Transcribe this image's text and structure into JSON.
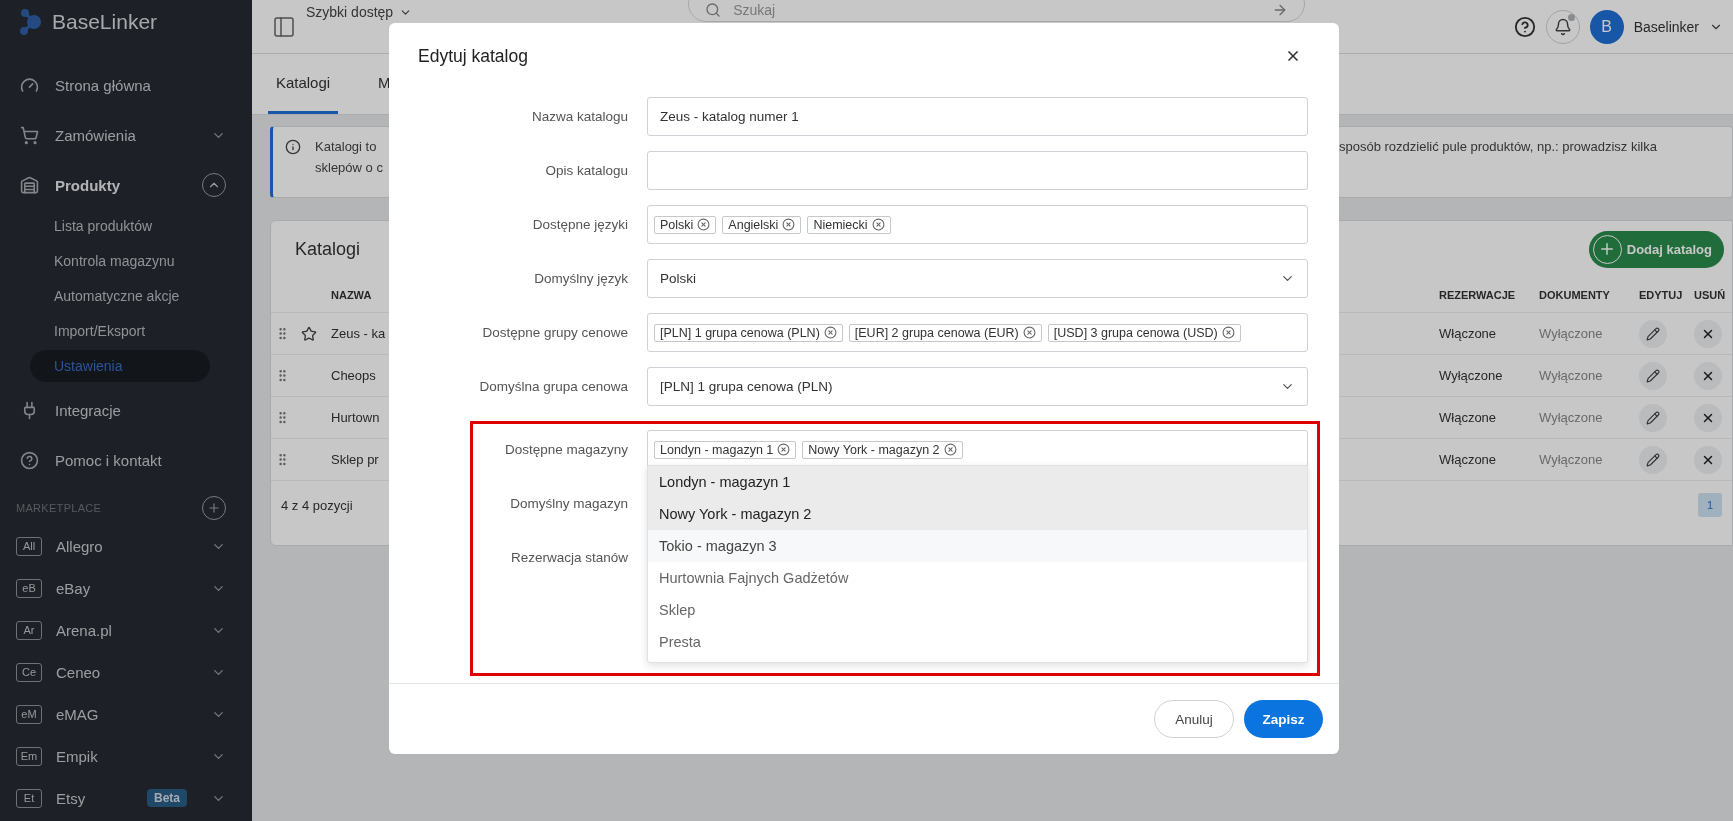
{
  "sidebar": {
    "logo": "BaseLinker",
    "nav": [
      {
        "label": "Strona główna",
        "kind": "link"
      },
      {
        "label": "Zamówienia",
        "kind": "group",
        "expanded": false
      },
      {
        "label": "Produkty",
        "kind": "group",
        "expanded": true,
        "children": [
          {
            "label": "Lista produktów",
            "selected": false
          },
          {
            "label": "Kontrola magazynu",
            "selected": false
          },
          {
            "label": "Automatyczne akcje",
            "selected": false
          },
          {
            "label": "Import/Eksport",
            "selected": false
          },
          {
            "label": "Ustawienia",
            "selected": true
          }
        ]
      },
      {
        "label": "Integracje",
        "kind": "link"
      },
      {
        "label": "Pomoc i kontakt",
        "kind": "link"
      }
    ],
    "marketplace": {
      "title": "MARKETPLACE",
      "items": [
        {
          "abbr": "All",
          "label": "Allegro"
        },
        {
          "abbr": "eB",
          "label": "eBay"
        },
        {
          "abbr": "Ar",
          "label": "Arena.pl"
        },
        {
          "abbr": "Ce",
          "label": "Ceneo"
        },
        {
          "abbr": "eM",
          "label": "eMAG"
        },
        {
          "abbr": "Em",
          "label": "Empik"
        },
        {
          "abbr": "Et",
          "label": "Etsy",
          "badge": "Beta"
        }
      ]
    }
  },
  "topbar": {
    "quick_access": "Szybki dostęp",
    "search": {
      "placeholder": "Szukaj"
    },
    "notifications": {
      "unread": true
    },
    "user": {
      "initial": "B",
      "name": "Baselinker"
    }
  },
  "tabs": [
    {
      "label": "Katalogi",
      "selected": true
    },
    {
      "label": "M",
      "selected": false
    }
  ],
  "info": {
    "left_lines": [
      "Katalogi to",
      "sklepów o c"
    ],
    "right_line": "sposób rozdzielić pule produktów, np.: prowadzisz kilka"
  },
  "catalogs": {
    "title": "Katalogi",
    "add_button": "Dodaj katalog",
    "columns": [
      "NAZWA",
      "REZERWACJE",
      "DOKUMENTY",
      "EDYTUJ",
      "USUŃ"
    ],
    "rows": [
      {
        "name": "Zeus - ka",
        "starred": true,
        "reservations": "Włączone",
        "documents": "Wyłączone"
      },
      {
        "name": "Cheops",
        "starred": false,
        "reservations": "Wyłączone",
        "documents": "Wyłączone"
      },
      {
        "name": "Hurtown",
        "starred": false,
        "reservations": "Włączone",
        "documents": "Wyłączone"
      },
      {
        "name": "Sklep pr",
        "starred": false,
        "reservations": "Włączone",
        "documents": "Wyłączone"
      }
    ],
    "count": "4 z 4 pozycji",
    "pages": [
      {
        "label": "1",
        "selected": true
      }
    ]
  },
  "modal": {
    "title": "Edytuj katalog",
    "fields": [
      {
        "label": "Nazwa katalogu",
        "kind": "text",
        "value": "Zeus - katalog numer 1"
      },
      {
        "label": "Opis katalogu",
        "kind": "text"
      },
      {
        "label": "Dostępne języki",
        "kind": "tags",
        "tags": [
          "Polski",
          "Angielski",
          "Niemiecki"
        ]
      },
      {
        "label": "Domyślny język",
        "kind": "select",
        "value": "Polski"
      },
      {
        "label": "Dostępne grupy cenowe",
        "kind": "tags",
        "tags": [
          "[PLN] 1 grupa cenowa (PLN)",
          "[EUR] 2 grupa cenowa (EUR)",
          "[USD] 3 grupa cenowa (USD)"
        ]
      },
      {
        "label": "Domyślna grupa cenowa",
        "kind": "select",
        "value": "[PLN] 1 grupa cenowa (PLN)"
      }
    ],
    "highlighted_fields": [
      {
        "label": "Dostępne magazyny",
        "kind": "tags",
        "tags": [
          "Londyn - magazyn 1",
          "Nowy York - magazyn 2"
        ],
        "options": [
          {
            "label": "Londyn - magazyn 1",
            "selected": true,
            "hovered": false
          },
          {
            "label": "Nowy York - magazyn 2",
            "selected": true,
            "hovered": false
          },
          {
            "label": "Tokio - magazyn 3",
            "selected": false,
            "hovered": true
          },
          {
            "label": "Hurtownia Fajnych Gadżetów",
            "selected": false,
            "hovered": false
          },
          {
            "label": "Sklep",
            "selected": false,
            "hovered": false
          },
          {
            "label": "Presta",
            "selected": false,
            "hovered": false
          }
        ]
      },
      {
        "label": "Domyślny magazyn",
        "kind": "covered"
      },
      {
        "label": "Rezerwacja stanów",
        "kind": "covered"
      }
    ],
    "buttons": [
      {
        "label": "Anuluj",
        "kind": "secondary"
      },
      {
        "label": "Zapisz",
        "kind": "primary"
      }
    ]
  }
}
